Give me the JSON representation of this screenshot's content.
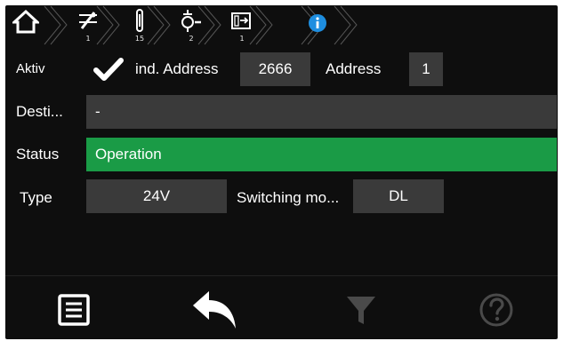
{
  "breadcrumb": {
    "items": [
      {
        "icon": "home-icon",
        "count": ""
      },
      {
        "icon": "switch-icon",
        "count": "1"
      },
      {
        "icon": "thermometer-icon",
        "count": "15"
      },
      {
        "icon": "lamp-icon",
        "count": "2"
      },
      {
        "icon": "exit-icon",
        "count": "1"
      },
      {
        "icon": "info-icon",
        "count": ""
      }
    ]
  },
  "row1": {
    "aktiv_label": "Aktiv",
    "checked": true,
    "ind_address_label": "ind. Address",
    "ind_address_value": "2666",
    "address_label": "Address",
    "address_value": "1"
  },
  "row2": {
    "label": "Desti...",
    "value": "-"
  },
  "row3": {
    "label": "Status",
    "value": "Operation"
  },
  "row4": {
    "type_label": "Type",
    "type_value": "24V",
    "switching_label": "Switching mo...",
    "switching_value": "DL"
  },
  "bottom": {
    "buttons": [
      "list-icon",
      "back-arrow-icon",
      "filter-icon",
      "help-icon"
    ]
  },
  "colors": {
    "status_green": "#1a9b46",
    "field_gray": "#3a3a3a",
    "info_blue": "#1e8ee0",
    "disabled_icon": "#4a4a4a"
  }
}
